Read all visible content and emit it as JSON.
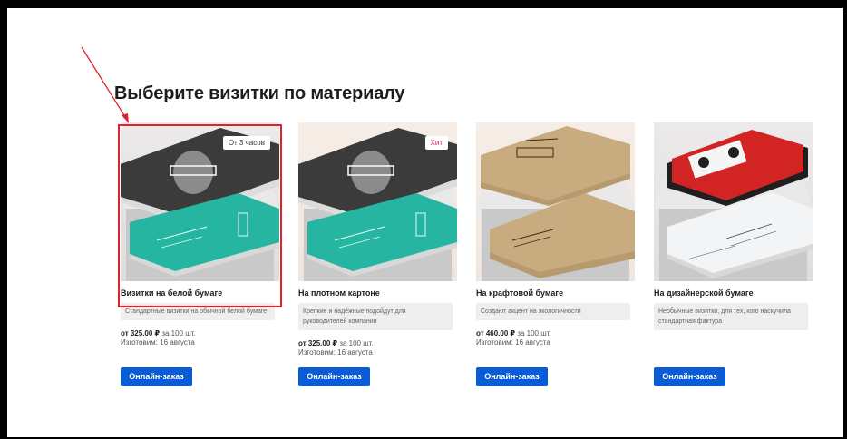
{
  "section": {
    "title": "Выберите визитки по материалу"
  },
  "cards": [
    {
      "badge": "От 3 часов",
      "title": "Визитки на белой бумаге",
      "description": "Стандартные визитки на обычной белой бумаге",
      "price": "от 325.00 ₽",
      "price_suffix": " за 100 шт.",
      "ready": "Изготовим: 16 августа",
      "button": "Онлайн-заказ"
    },
    {
      "badge": "Хит",
      "title": "На плотном картоне",
      "description": "Крепкие и надёжные подойдут для руководителей компании",
      "price": "от 325.00 ₽",
      "price_suffix": " за 100 шт.",
      "ready": "Изготовим: 16 августа",
      "button": "Онлайн-заказ"
    },
    {
      "title": "На крафтовой бумаге",
      "description": "Создают акцент на экологичности",
      "price": "от 460.00 ₽",
      "price_suffix": " за 100 шт.",
      "ready": "Изготовим: 16 августа",
      "button": "Онлайн-заказ"
    },
    {
      "title": "На дизайнерской бумаге",
      "description": "Необычные визитки, для тех, кого наскучила стандартная фактура",
      "button": "Онлайн-заказ"
    }
  ],
  "colors": {
    "accent": "#0a5bd6",
    "highlight": "#e0232b",
    "hit_badge": "#d6245a"
  }
}
